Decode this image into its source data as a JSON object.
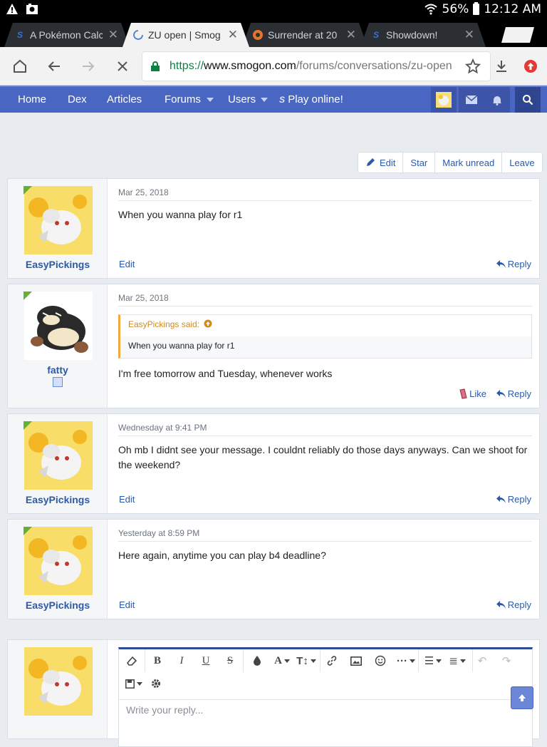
{
  "status_bar": {
    "battery": "56%",
    "time": "12:12 AM"
  },
  "tabs": [
    {
      "title": "A Pokémon Calc",
      "favicon": "smogon-icon"
    },
    {
      "title": "ZU open | Smogon",
      "favicon": "loading-spinner-icon",
      "active": true
    },
    {
      "title": "Surrender at 20",
      "favicon": "surrender-icon"
    },
    {
      "title": "Showdown!",
      "favicon": "smogon-icon"
    }
  ],
  "address_bar": {
    "scheme": "https://",
    "host": "www.smogon.com",
    "path": "/forums/conversations/zu-open"
  },
  "site_nav": {
    "items": [
      "Home",
      "Dex",
      "Articles",
      "Forums",
      "Users",
      "Play online!"
    ]
  },
  "conversation_actions": [
    "Edit",
    "Star",
    "Mark unread",
    "Leave"
  ],
  "messages": [
    {
      "author": "EasyPickings",
      "date": "Mar 25, 2018",
      "body": "When you wanna play for r1",
      "actions": {
        "edit": "Edit",
        "reply": "Reply"
      }
    },
    {
      "author": "fatty",
      "date": "Mar 25, 2018",
      "quote": {
        "header": "EasyPickings said:",
        "text": "When you wanna play for r1"
      },
      "body": "I'm free tomorrow and Tuesday, whenever works",
      "actions": {
        "like": "Like",
        "reply": "Reply"
      }
    },
    {
      "author": "EasyPickings",
      "date": "Wednesday at 9:41 PM",
      "body": "Oh mb I didnt see your message. I couldnt reliably do those days anyways. Can we shoot for the weekend?",
      "actions": {
        "edit": "Edit",
        "reply": "Reply"
      }
    },
    {
      "author": "EasyPickings",
      "date": "Yesterday at 8:59 PM",
      "body": "Here again, anytime you can play b4 deadline?",
      "actions": {
        "edit": "Edit",
        "reply": "Reply"
      }
    }
  ],
  "reply_editor": {
    "placeholder": "Write your reply..."
  },
  "colors": {
    "nav": "#4a66c3",
    "link": "#2b5aa8",
    "online": "#63b132"
  }
}
